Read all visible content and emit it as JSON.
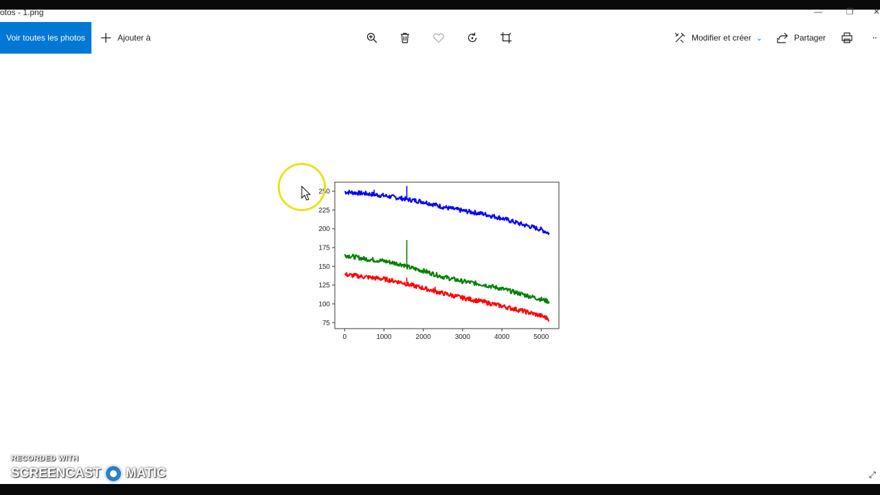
{
  "app": {
    "title": "otos - 1.png",
    "window_controls": [
      "—",
      "❐",
      "✕"
    ]
  },
  "toolbar": {
    "view_all_label": "Voir toutes les photos",
    "add_to_label": "Ajouter à",
    "edit_create_label": "Modifier et créer",
    "share_label": "Partager",
    "icons": [
      "zoom-icon",
      "delete-icon",
      "favorite-icon",
      "rotate-icon",
      "crop-icon",
      "edit-icon",
      "share-icon",
      "print-icon",
      "more-icon"
    ]
  },
  "watermark": {
    "line1": "RECORDED WITH",
    "line2a": "SCREENCAST",
    "line2b": "MATIC"
  },
  "chart_data": {
    "type": "line",
    "title": "",
    "xlabel": "",
    "ylabel": "",
    "xlim": [
      -250,
      5450
    ],
    "ylim": [
      67,
      262
    ],
    "xticks": [
      0,
      1000,
      2000,
      3000,
      4000,
      5000
    ],
    "yticks": [
      75,
      100,
      125,
      150,
      175,
      200,
      225,
      250
    ],
    "legend": "none",
    "grid": false,
    "series": [
      {
        "color": "#0000ff",
        "x": [
          0,
          500,
          1000,
          1500,
          1600,
          2000,
          2500,
          3000,
          3500,
          4000,
          4500,
          5000,
          5200
        ],
        "y": [
          249,
          247,
          244,
          240,
          239,
          236,
          229,
          224,
          220,
          214,
          206,
          199,
          194
        ],
        "spikes": [
          {
            "x": 1580,
            "y": 257
          },
          {
            "x": 750,
            "y": 252
          }
        ]
      },
      {
        "color": "#008000",
        "x": [
          0,
          500,
          1000,
          1500,
          1600,
          2000,
          2500,
          3000,
          3500,
          4000,
          4500,
          5000,
          5200
        ],
        "y": [
          165,
          160,
          157,
          152,
          149,
          144,
          136,
          130,
          126,
          120,
          113,
          106,
          103
        ],
        "spikes": [
          {
            "x": 1580,
            "y": 185
          }
        ]
      },
      {
        "color": "#ff0000",
        "x": [
          0,
          500,
          1000,
          1500,
          1600,
          2000,
          2500,
          3000,
          3500,
          4000,
          4500,
          5000,
          5200
        ],
        "y": [
          139,
          136,
          133,
          128,
          126,
          121,
          114,
          108,
          103,
          97,
          91,
          84,
          80
        ],
        "spikes": [
          {
            "x": 1580,
            "y": 135
          },
          {
            "x": 2300,
            "y": 123
          }
        ]
      }
    ]
  }
}
